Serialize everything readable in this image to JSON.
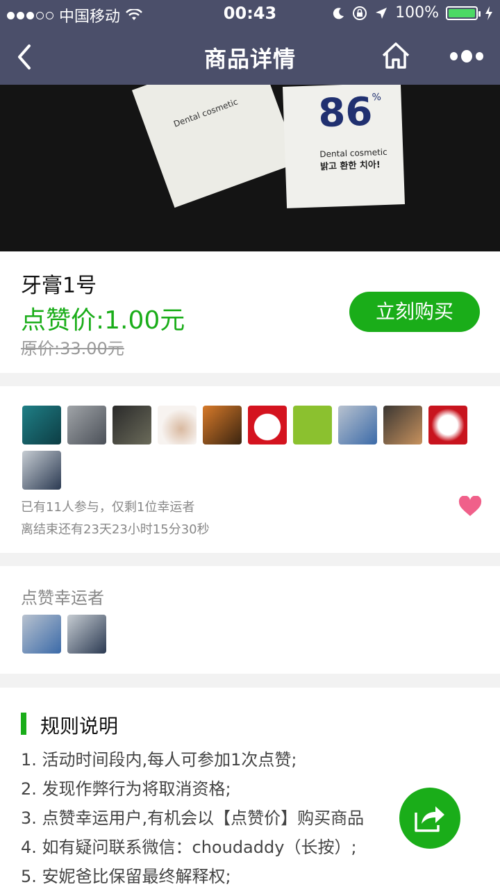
{
  "status_bar": {
    "carrier": "中国移动",
    "time": "00:43",
    "battery": "100%"
  },
  "nav": {
    "title": "商品详情"
  },
  "hero": {
    "box_number": "86",
    "box_percent": "%",
    "box_line1": "Dental cosmetic",
    "box_line2": "밝고 환한 치아!"
  },
  "product": {
    "name": "牙膏1号",
    "like_price": "点赞价:1.00元",
    "original_price": "原价:33.00元",
    "buy_label": "立刻购买"
  },
  "participants": {
    "summary": "已有11人参与，仅剩1位幸运者",
    "countdown": "离结束还有23天23小时15分30秒",
    "avatars": [
      "diver",
      "laptop",
      "camera",
      "cat",
      "tiger",
      "lucky-cat",
      "graduation",
      "photographer",
      "child-eating",
      "anime",
      "child-standing"
    ]
  },
  "lucky": {
    "title": "点赞幸运者",
    "avatars": [
      "photographer",
      "child-standing"
    ]
  },
  "rules": {
    "title": "规则说明",
    "items": [
      "1. 活动时间段内,每人可参加1次点赞;",
      "2. 发现作弊行为将取消资格;",
      "3. 点赞幸运用户,有机会以【点赞价】购买商品",
      "4. 如有疑问联系微信：choudaddy（长按）;",
      "5. 安妮爸比保留最终解释权;"
    ]
  },
  "colors": {
    "nav_bg": "#4b4f6a",
    "accent_green": "#1aad19",
    "heart": "#f0608a"
  }
}
